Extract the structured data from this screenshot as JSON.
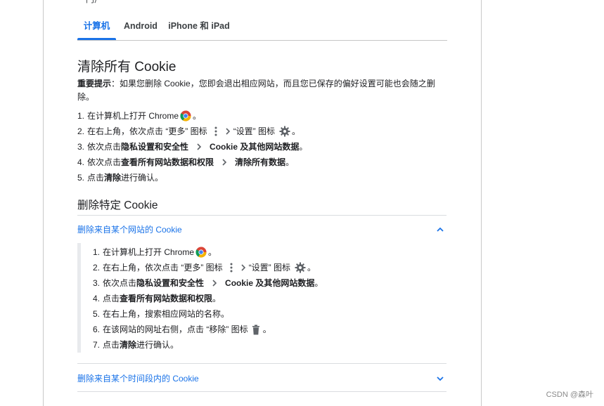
{
  "top_cut": "门户",
  "tabs": [
    {
      "label": "计算机"
    },
    {
      "label": "Android"
    },
    {
      "label": "iPhone 和 iPad"
    }
  ],
  "section1": {
    "title": "清除所有 Cookie",
    "note_label": "重要提示",
    "note_text": "：如果您删除 Cookie，您即会退出相应网站，而且您已保存的偏好设置可能也会随之删除。",
    "steps": {
      "s1_num": "1.",
      "s1_pre": "在计算机上打开 Chrome",
      "s1_end": "。",
      "s2_num": "2.",
      "s2_pre": "在右上角，依次点击 “更多” 图标",
      "s2_mid": "“设置” 图标",
      "s2_end": "。",
      "s3_num": "3.",
      "s3_pre": "依次点击",
      "s3_b1": "隐私设置和安全性",
      "s3_b2": "Cookie 及其他网站数据",
      "s3_end": "。",
      "s4_num": "4.",
      "s4_pre": "依次点击",
      "s4_b1": "查看所有网站数据和权限",
      "s4_b2": "清除所有数据",
      "s4_end": "。",
      "s5_num": "5.",
      "s5_pre": "点击",
      "s5_b1": "清除",
      "s5_end": "进行确认。"
    }
  },
  "section2": {
    "title": "删除特定 Cookie",
    "accordion1": {
      "title": "删除来自某个网站的 Cookie",
      "steps": {
        "s1_num": "1.",
        "s1_pre": "在计算机上打开 Chrome",
        "s1_end": "。",
        "s2_num": "2.",
        "s2_pre": "在右上角，依次点击 “更多” 图标",
        "s2_mid": "“设置” 图标",
        "s2_end": "。",
        "s3_num": "3.",
        "s3_pre": "依次点击",
        "s3_b1": "隐私设置和安全性",
        "s3_b2": "Cookie 及其他网站数据",
        "s3_end": "。",
        "s4_num": "4.",
        "s4_pre": "点击",
        "s4_b1": "查看所有网站数据和权限",
        "s4_end": "。",
        "s5_num": "5.",
        "s5_text": "在右上角，搜索相应网站的名称。",
        "s6_num": "6.",
        "s6_pre": "在该网站的网址右侧，点击 “移除” 图标",
        "s6_end": "。",
        "s7_num": "7.",
        "s7_pre": "点击",
        "s7_b1": "清除",
        "s7_end": "进行确认。"
      }
    },
    "accordion2": {
      "title": "删除来自某个时间段内的 Cookie"
    }
  },
  "footer": "CSDN @森叶",
  "colors": {
    "accent": "#1a73e8",
    "text": "#202124",
    "divider": "#dadce0",
    "icon_gray": "#5f6368"
  },
  "icons": [
    "chrome-icon",
    "more-vert-icon",
    "chevron-right-icon",
    "gear-icon",
    "trash-icon",
    "chevron-up-icon",
    "chevron-down-icon"
  ]
}
